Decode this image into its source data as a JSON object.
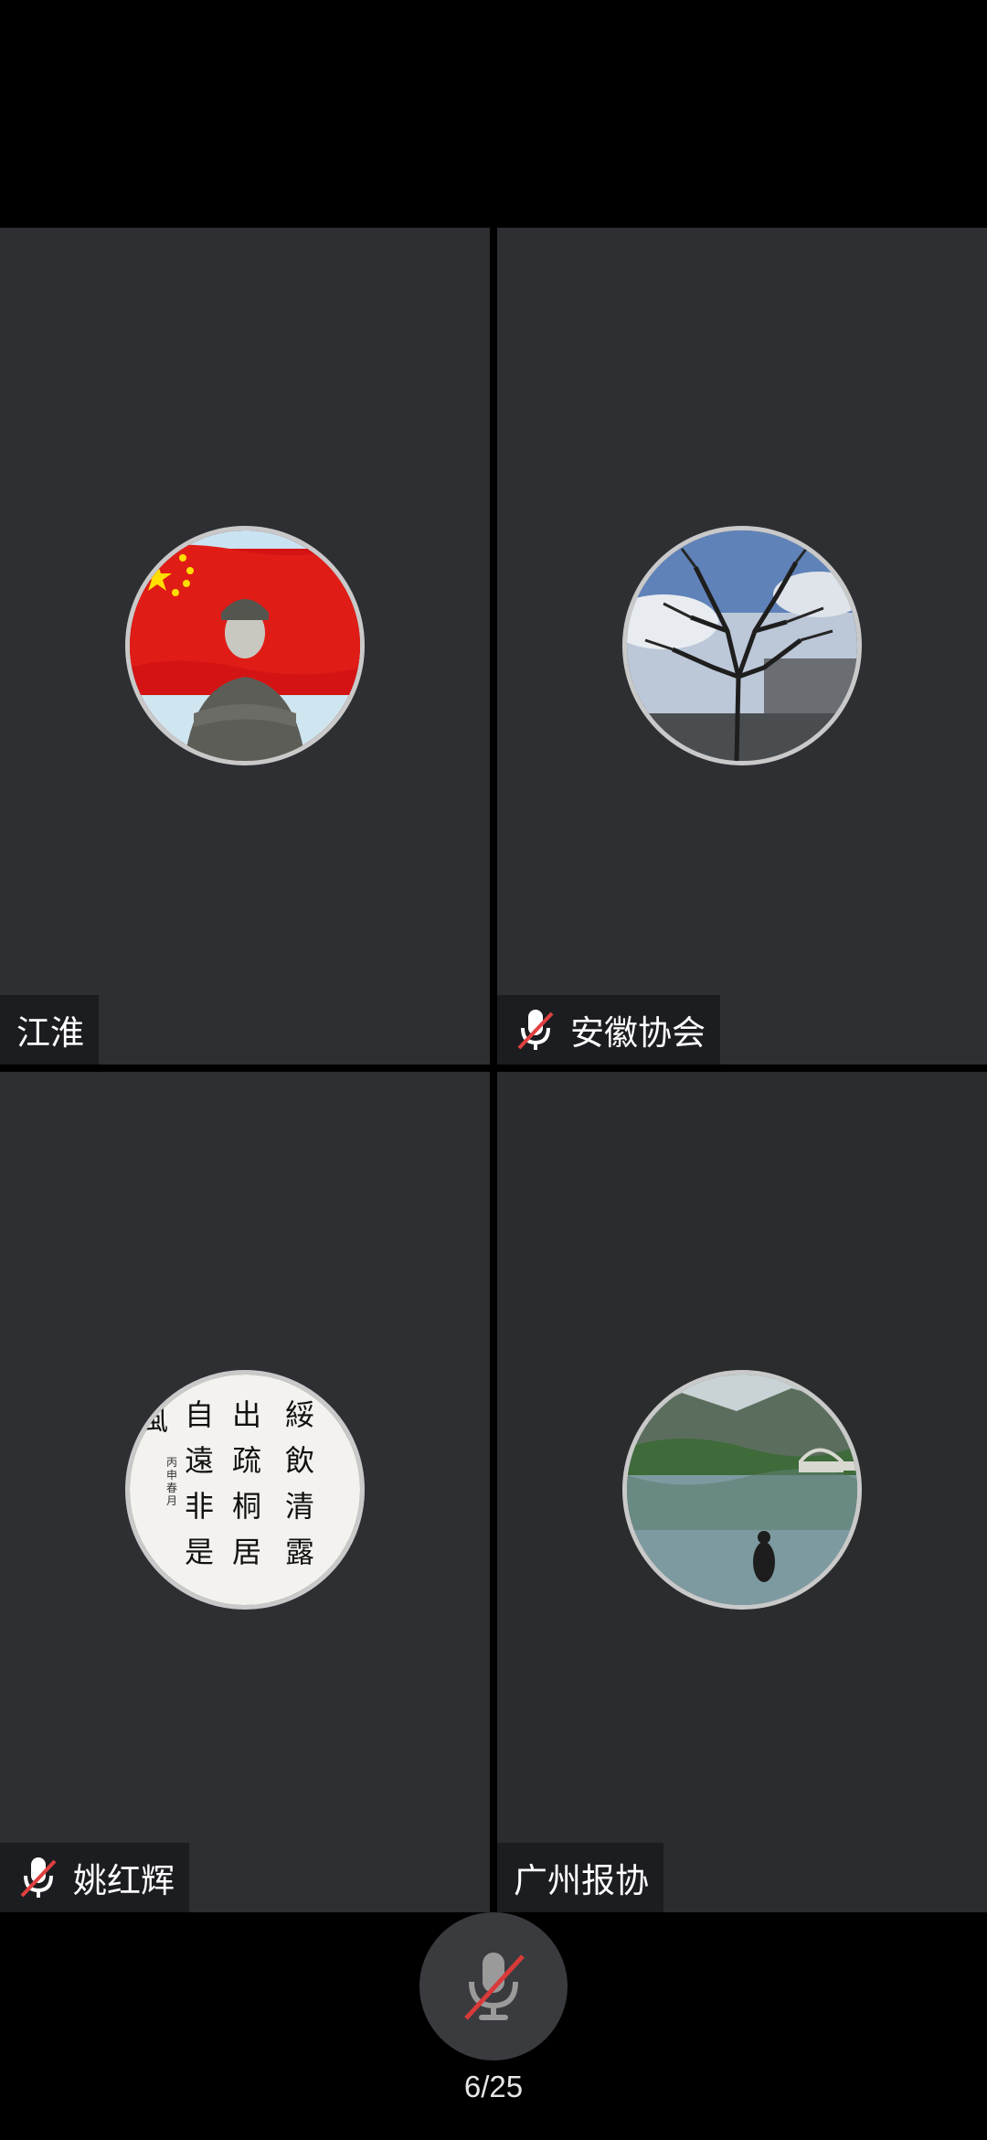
{
  "participants": [
    {
      "name": "江淮",
      "muted": false,
      "avatar": "flag-portrait"
    },
    {
      "name": "安徽协会",
      "muted": true,
      "avatar": "bare-tree"
    },
    {
      "name": "姚红辉",
      "muted": true,
      "avatar": "calligraphy"
    },
    {
      "name": "广州报协",
      "muted": false,
      "avatar": "lake-scene"
    }
  ],
  "calligraphy_text": "風自遠非是出疏桐居綏飲清露",
  "bottom": {
    "mic_icon": "mic-muted-icon",
    "page_indicator": "6/25"
  },
  "colors": {
    "tile_bg": "#2d2f33",
    "nameplate_bg": "#1c1d20",
    "mute_slash": "#e04040"
  }
}
